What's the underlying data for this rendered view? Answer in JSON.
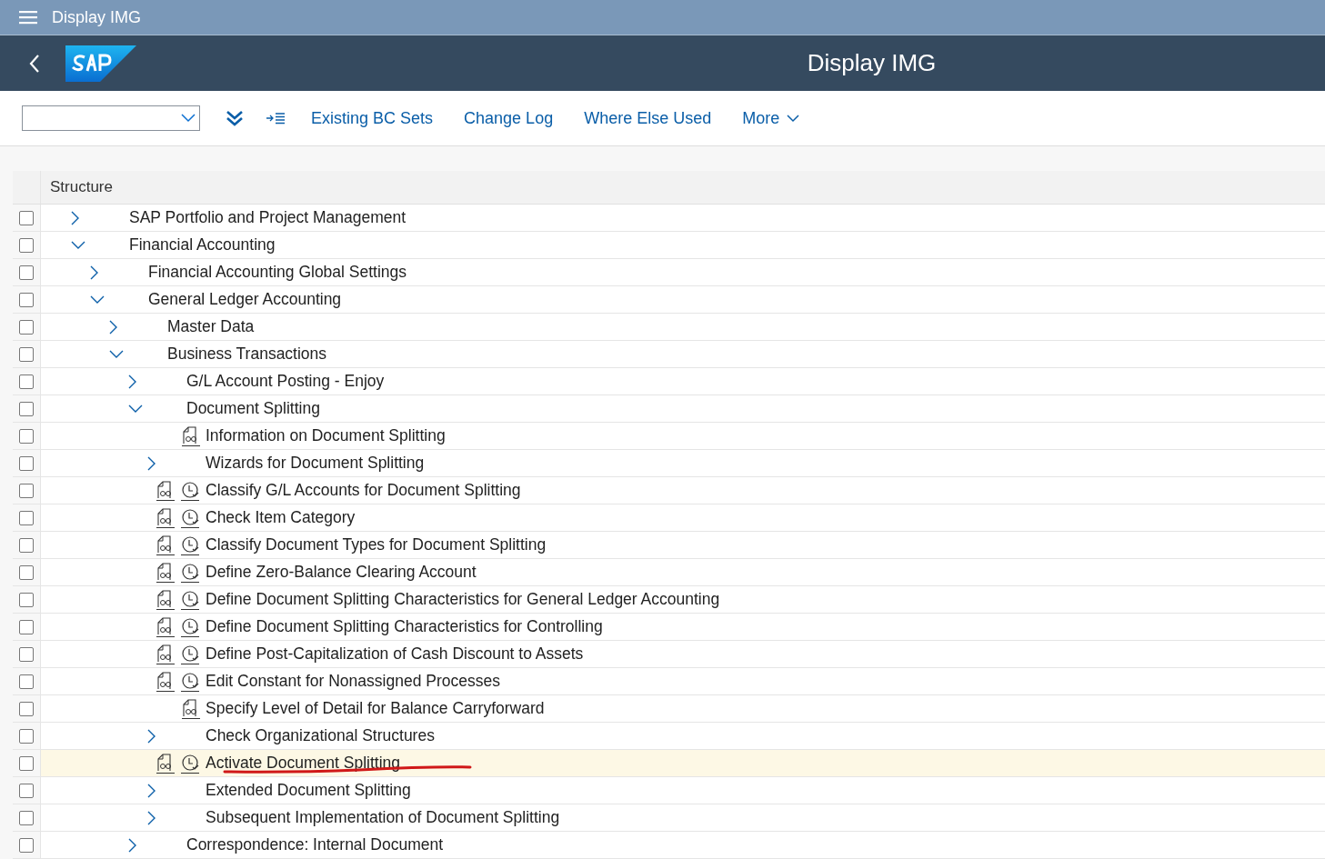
{
  "shell_bar": {
    "title": "Display IMG"
  },
  "header": {
    "title": "Display IMG"
  },
  "toolbar": {
    "buttons": [
      "Existing BC Sets",
      "Change Log",
      "Where Else Used"
    ],
    "more": "More"
  },
  "table": {
    "column": "Structure",
    "rows": [
      {
        "kind": "folder",
        "label": "SAP Portfolio and Project Management",
        "expanded": false,
        "selected": false
      },
      {
        "kind": "folder",
        "label": "Financial Accounting",
        "expanded": true,
        "selected": false,
        "children": [
          {
            "kind": "folder",
            "label": "Financial Accounting Global Settings",
            "expanded": false,
            "selected": false
          },
          {
            "kind": "folder",
            "label": "General Ledger Accounting",
            "expanded": true,
            "selected": false,
            "children": [
              {
                "kind": "folder",
                "label": "Master Data",
                "expanded": false,
                "selected": false
              },
              {
                "kind": "folder",
                "label": "Business Transactions",
                "expanded": true,
                "selected": false,
                "children": [
                  {
                    "kind": "folder",
                    "label": "G/L Account Posting - Enjoy",
                    "expanded": false,
                    "selected": false
                  },
                  {
                    "kind": "folder",
                    "label": "Document Splitting",
                    "expanded": true,
                    "selected": false,
                    "children": [
                      {
                        "kind": "info",
                        "label": "Information on Document Splitting",
                        "selected": false
                      },
                      {
                        "kind": "folder",
                        "label": "Wizards for Document Splitting",
                        "expanded": false,
                        "selected": false
                      },
                      {
                        "kind": "activity",
                        "label": "Classify G/L Accounts for Document Splitting",
                        "selected": false
                      },
                      {
                        "kind": "activity",
                        "label": "Check Item Category",
                        "selected": false
                      },
                      {
                        "kind": "activity",
                        "label": "Classify Document Types for Document Splitting",
                        "selected": false
                      },
                      {
                        "kind": "activity",
                        "label": "Define Zero-Balance Clearing Account",
                        "selected": false
                      },
                      {
                        "kind": "activity",
                        "label": "Define Document Splitting Characteristics for General Ledger Accounting",
                        "selected": false
                      },
                      {
                        "kind": "activity",
                        "label": "Define Document Splitting Characteristics for Controlling",
                        "selected": false
                      },
                      {
                        "kind": "activity",
                        "label": "Define Post-Capitalization of Cash Discount to Assets",
                        "selected": false
                      },
                      {
                        "kind": "activity",
                        "label": "Edit Constant for Nonassigned Processes",
                        "selected": false
                      },
                      {
                        "kind": "info",
                        "label": "Specify Level of Detail for Balance Carryforward",
                        "selected": false
                      },
                      {
                        "kind": "folder",
                        "label": "Check Organizational Structures",
                        "expanded": false,
                        "selected": false
                      },
                      {
                        "kind": "activity",
                        "label": "Activate Document Splitting",
                        "selected": true,
                        "underlined": true
                      },
                      {
                        "kind": "folder",
                        "label": "Extended Document Splitting",
                        "expanded": false,
                        "selected": false
                      },
                      {
                        "kind": "folder",
                        "label": "Subsequent Implementation of Document Splitting",
                        "expanded": false,
                        "selected": false
                      }
                    ]
                  },
                  {
                    "kind": "folder",
                    "label": "Correspondence: Internal Document",
                    "expanded": false,
                    "selected": false
                  }
                ]
              }
            ]
          }
        ]
      }
    ]
  }
}
